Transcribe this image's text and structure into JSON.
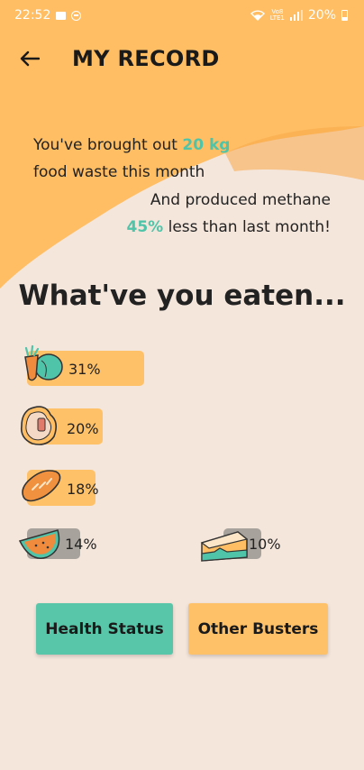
{
  "status_bar": {
    "time": "22:52",
    "volte": "Vo8\nLTE1",
    "battery": "20%",
    "icons": [
      "image-icon",
      "dnd-icon",
      "wifi-icon",
      "signal-icon",
      "battery-icon"
    ]
  },
  "header": {
    "back_icon": "arrow-left-icon",
    "title": "MY RECORD"
  },
  "summary": {
    "line1_prefix": "You've brought out ",
    "waste_amount": "20 kg",
    "line2": "food waste this month",
    "line3": "And produced methane",
    "methane_pct": "45%",
    "line4_suffix": " less than last month!"
  },
  "section_title": "What've you eaten...",
  "foods": [
    {
      "name": "vegetables",
      "icon": "carrot-cabbage-icon",
      "percent": 0.31,
      "label": "31%"
    },
    {
      "name": "meat",
      "icon": "steak-icon",
      "percent": 0.2,
      "label": "20%"
    },
    {
      "name": "bread",
      "icon": "bread-icon",
      "percent": 0.18,
      "label": "18%"
    },
    {
      "name": "fruit",
      "icon": "melon-icon",
      "percent": 0.14,
      "label": "14%"
    },
    {
      "name": "cake",
      "icon": "cake-icon",
      "percent": 0.1,
      "label": "10%"
    }
  ],
  "buttons": {
    "health_status": "Health Status",
    "other_busters": "Other Busters"
  },
  "colors": {
    "background": "#f5e6dc",
    "wave": "#ffbe63",
    "accent": "#4fc4a9",
    "bar": "#ffc168",
    "bar_gray": "#a8a29c",
    "button_health": "#58c6a9",
    "button_other": "#ffc168"
  }
}
